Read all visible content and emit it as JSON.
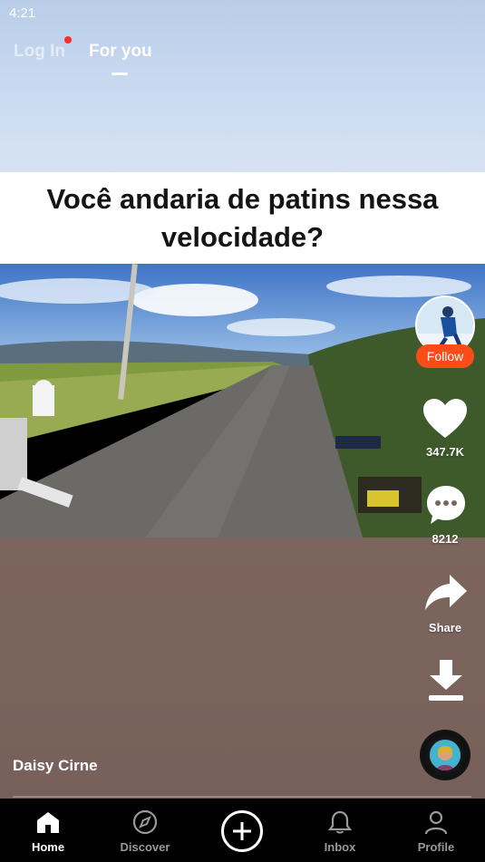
{
  "status_bar": {
    "time": "4:21"
  },
  "top_tabs": {
    "login": "Log In",
    "for_you": "For you"
  },
  "video": {
    "caption": "Você andaria de patins nessa velocidade?"
  },
  "right_rail": {
    "follow_label": "Follow",
    "likes": "347.7K",
    "comments": "8212",
    "share_label": "Share"
  },
  "author": {
    "name": "Daisy Cirne"
  },
  "bottom_nav": {
    "home": "Home",
    "discover": "Discover",
    "inbox": "Inbox",
    "profile": "Profile"
  },
  "colors": {
    "follow": "#fe4b1a",
    "notification_dot": "#fe2c2c",
    "nav_inactive": "#999999"
  }
}
